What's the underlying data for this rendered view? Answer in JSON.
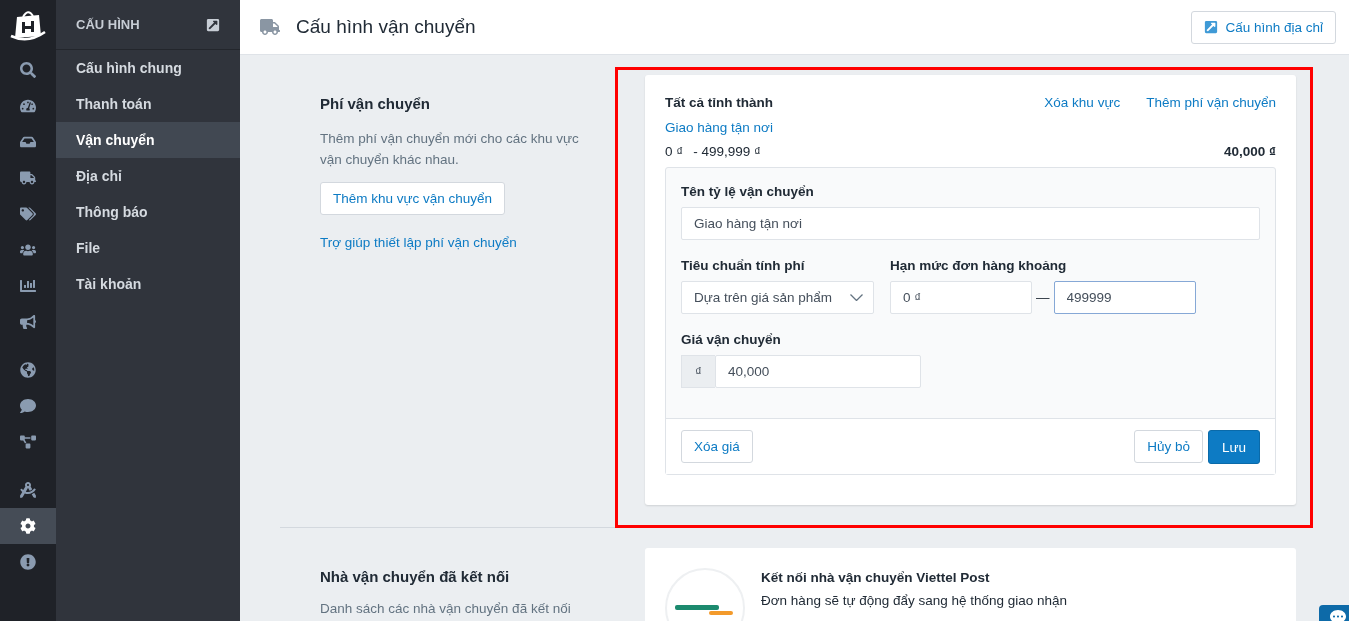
{
  "icon_rail": [
    [
      {
        "selected": false
      },
      {
        "selected": false
      },
      {
        "selected": false
      },
      {
        "selected": false
      },
      {
        "selected": false
      },
      {
        "selected": false
      },
      {
        "selected": false
      },
      {
        "selected": false
      }
    ],
    [
      {
        "selected": false
      },
      {
        "selected": false
      },
      {
        "selected": false
      }
    ],
    [
      {
        "selected": false
      },
      {
        "selected": true
      },
      {
        "selected": false
      }
    ]
  ],
  "sidebar": {
    "title": "CẤU HÌNH",
    "items": [
      {
        "label": "Cấu hình chung",
        "selected": false
      },
      {
        "label": "Thanh toán",
        "selected": false
      },
      {
        "label": "Vận chuyển",
        "selected": true
      },
      {
        "label": "Địa chỉ",
        "selected": false
      },
      {
        "label": "Thông báo",
        "selected": false
      },
      {
        "label": "File",
        "selected": false
      },
      {
        "label": "Tài khoản",
        "selected": false
      }
    ]
  },
  "header": {
    "title": "Cấu hình vận chuyển",
    "button": "Cấu hình địa chỉ"
  },
  "shipping_fees": {
    "title": "Phí vận chuyển",
    "description": "Thêm phí vận chuyển mới cho các khu vực vận chuyển khác nhau.",
    "add_button": "Thêm khu vực vận chuyển",
    "help_link": "Trợ giúp thiết lập phí vận chuyển",
    "zone": {
      "name": "Tất cả tỉnh thành",
      "delete_link": "Xóa khu vực",
      "add_link": "Thêm phí vận chuyển",
      "rate_link": "Giao hàng tận nơi",
      "range_from": "0 ₫",
      "range_to": "- 499,999 ₫",
      "price": "40,000 ₫",
      "editor": {
        "name_label": "Tên tỷ lệ vận chuyển",
        "name_value": "Giao hàng tận nơi",
        "criteria_label": "Tiêu chuẩn tính phí",
        "criteria_value": "Dựa trên giá sản phẩm",
        "range_label": "Hạn mức đơn hàng khoảng",
        "range_min": "0 ₫",
        "range_separator": "—",
        "range_max": "499999",
        "price_label": "Giá vận chuyển",
        "currency": "₫",
        "price_value": "40,000",
        "delete_button": "Xóa giá",
        "cancel_button": "Hủy bỏ",
        "save_button": "Lưu"
      }
    }
  },
  "carriers": {
    "title": "Nhà vận chuyển đã kết nối",
    "description": "Danh sách các nhà vận chuyển đã kết nối",
    "card_title": "Kết nối nhà vận chuyển Viettel Post",
    "card_text": "Đơn hàng sẽ tự động đẩy sang hệ thống giao nhận"
  }
}
